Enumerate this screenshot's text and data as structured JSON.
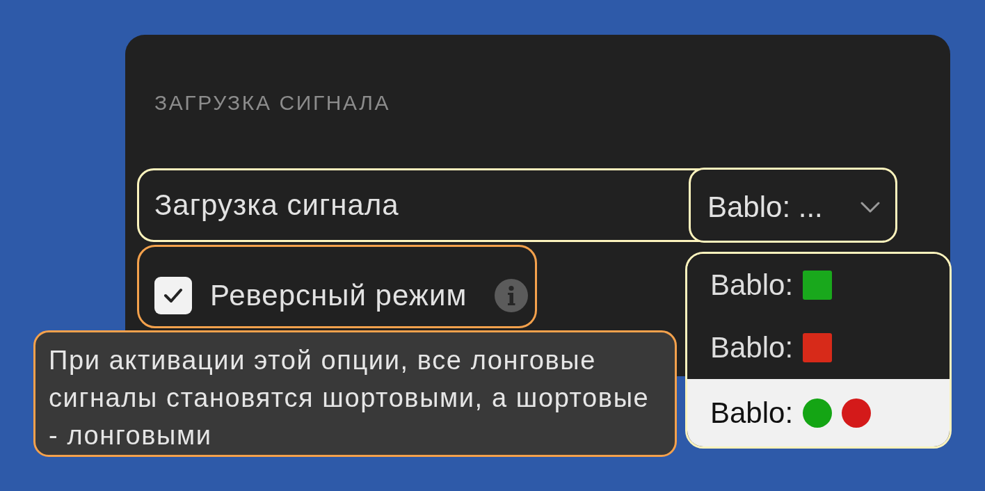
{
  "section": {
    "title": "ЗАГРУЗКА СИГНАЛА"
  },
  "signal_row": {
    "label": "Загрузка сигнала",
    "select": {
      "value": "Bablo: ..."
    }
  },
  "reverse_row": {
    "label": "Реверсный режим",
    "checked": true
  },
  "tooltip": {
    "text": "При активации этой опции, все лонговые сигналы становятся шортовыми, а шортовые - лонговыми"
  },
  "dropdown": {
    "options": [
      {
        "label": "Bablo:",
        "selected": false,
        "markers": [
          {
            "kind": "square",
            "color": "#19a81c"
          }
        ]
      },
      {
        "label": "Bablo:",
        "selected": false,
        "markers": [
          {
            "kind": "square",
            "color": "#d72a19"
          }
        ]
      },
      {
        "label": "Bablo:",
        "selected": true,
        "markers": [
          {
            "kind": "circle",
            "color": "#14a514"
          },
          {
            "kind": "circle",
            "color": "#d41a1a"
          }
        ]
      }
    ]
  }
}
